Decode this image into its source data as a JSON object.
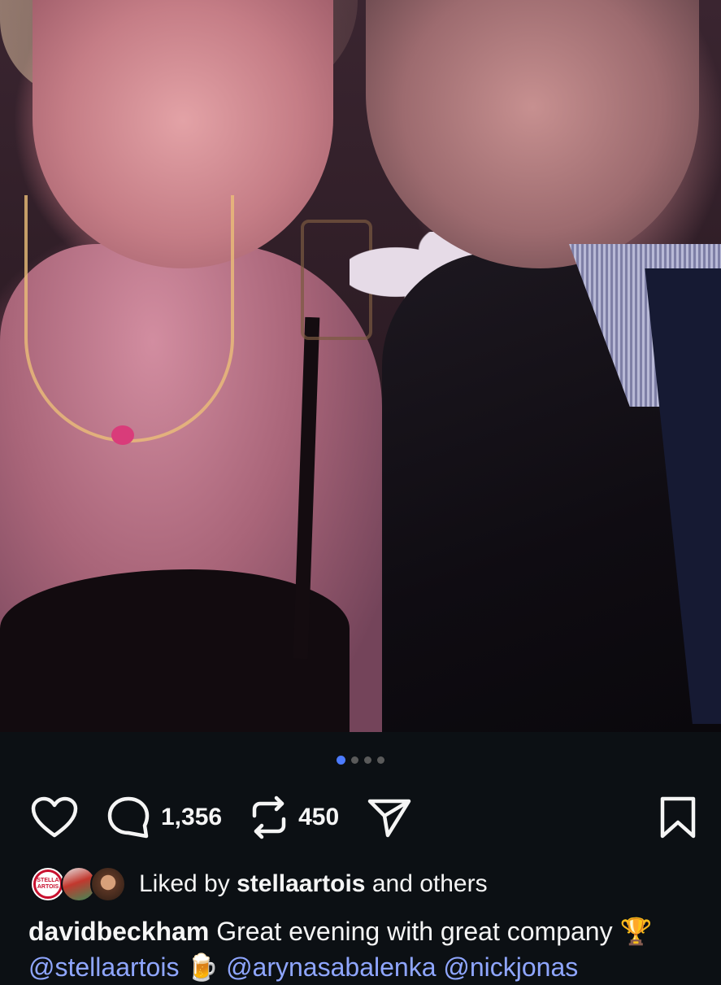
{
  "post": {
    "image_alt_name": "selfie-photo",
    "carousel": {
      "total": 4,
      "active": 1
    }
  },
  "actions": {
    "replies": "1,356",
    "reposts": "450"
  },
  "liked": {
    "prefix": "Liked by ",
    "user": "stellaartois",
    "suffix": " and others",
    "avatar1_text_top": "STELLA",
    "avatar1_text_bottom": "ARTOIS"
  },
  "caption": {
    "username": "davidbeckham",
    "text": " Great evening with great company ",
    "emoji_trophy": "🏆",
    "mention1": "@stellaartois",
    "emoji_beer": "🍺",
    "mention2": "@arynasabalenka",
    "mention3": "@nickjonas"
  },
  "colors": {
    "background": "#0c1014",
    "accent_dot": "#4c7bff",
    "mention": "#8fa6ff"
  },
  "icons": [
    "heart-icon",
    "reply-bubble-icon",
    "repost-icon",
    "share-send-icon",
    "bookmark-icon"
  ]
}
